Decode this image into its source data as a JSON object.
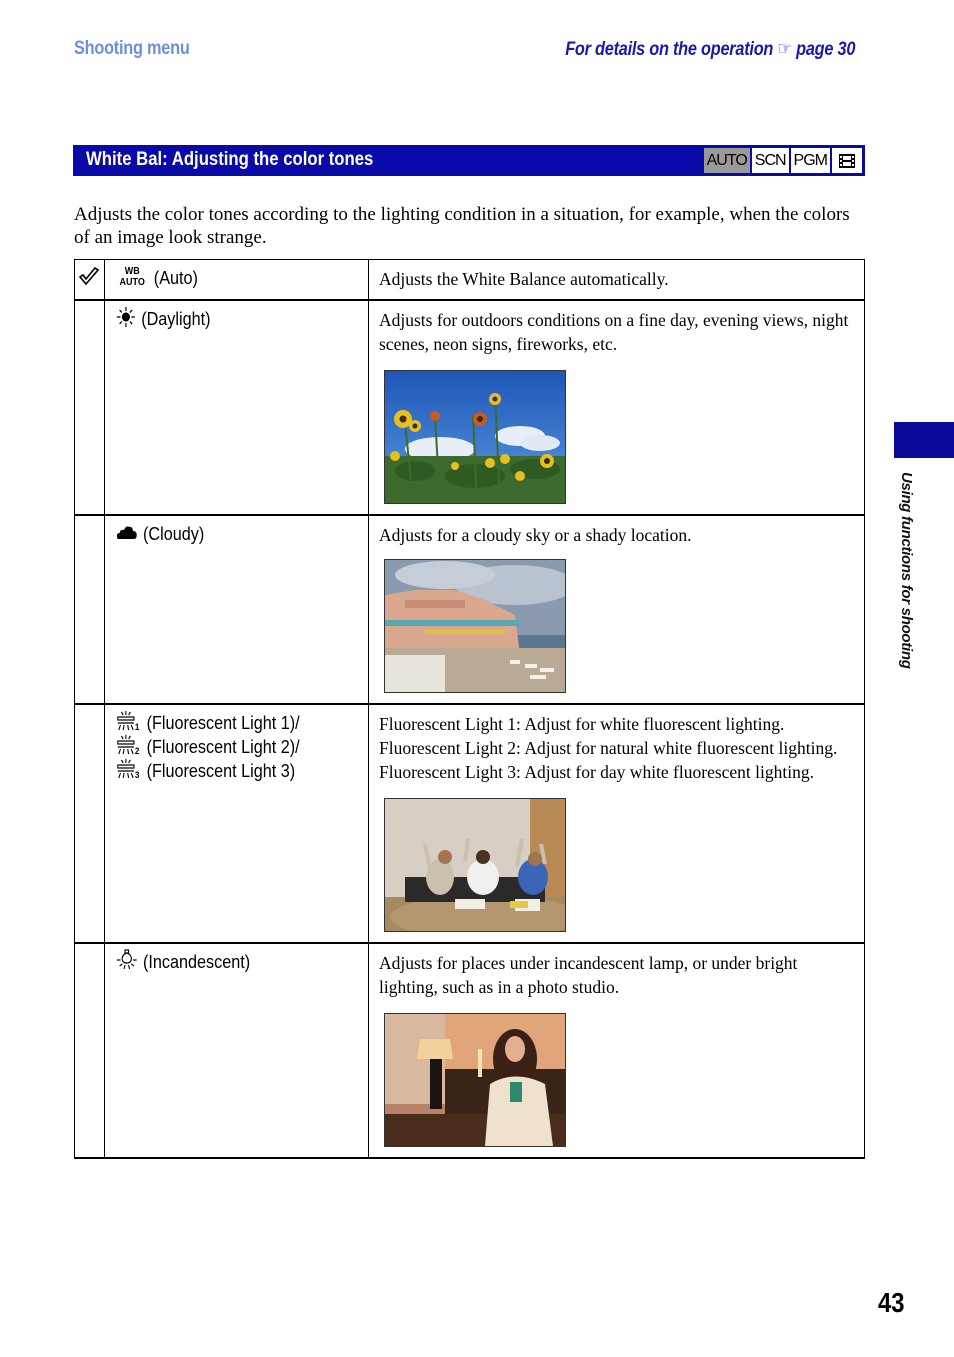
{
  "header": {
    "section": "Shooting menu",
    "operation_ref_prefix": "For details on the operation",
    "operation_ref_icon": "pointing-hand-icon",
    "operation_ref_page": "page 30"
  },
  "section_bar": {
    "title": "White Bal: Adjusting the color tones",
    "modes": [
      {
        "label": "AUTO",
        "active": true
      },
      {
        "label": "SCN",
        "active": false
      },
      {
        "label": "PGM",
        "active": false
      },
      {
        "label": "movie",
        "icon": "film-icon",
        "active": false
      }
    ]
  },
  "intro": "Adjusts the color tones according to the lighting condition in a situation, for example, when the colors of an image look strange.",
  "side_tab": {
    "label": "Using functions for shooting"
  },
  "settings": [
    {
      "icon": "wb-auto-icon",
      "default": true,
      "lines": [
        "(Auto)"
      ],
      "description": "Adjusts the White Balance automatically.",
      "photo": null
    },
    {
      "icon": "sun-icon",
      "default": false,
      "lines": [
        "(Daylight)"
      ],
      "description": "Adjusts for outdoors conditions on a fine day, evening views, night scenes, neon signs, fireworks, etc.",
      "photo": "sunflowers under blue sky"
    },
    {
      "icon": "cloud-icon",
      "default": false,
      "lines": [
        "(Cloudy)"
      ],
      "description": "Adjusts for a cloudy sky or a shady location.",
      "photo": "seaside hotel under cloudy sky"
    },
    {
      "icon": "fluorescent-icon",
      "default": false,
      "lines": [
        "(Fluorescent Light 1)/",
        "(Fluorescent Light 2)/",
        "(Fluorescent Light 3)"
      ],
      "description_lines": [
        "Fluorescent Light 1: Adjust for white fluorescent lighting.",
        "Fluorescent Light 2: Adjust for natural white fluorescent lighting.",
        "Fluorescent Light 3: Adjust for day white fluorescent lighting."
      ],
      "photo": "three men cheering in office"
    },
    {
      "icon": "incandescent-icon",
      "default": false,
      "lines": [
        "(Incandescent)"
      ],
      "description": "Adjusts for places under incandescent lamp, or under bright lighting, such as in a photo studio.",
      "photo": "woman with glass under lamp light"
    }
  ],
  "page_number": "43"
}
